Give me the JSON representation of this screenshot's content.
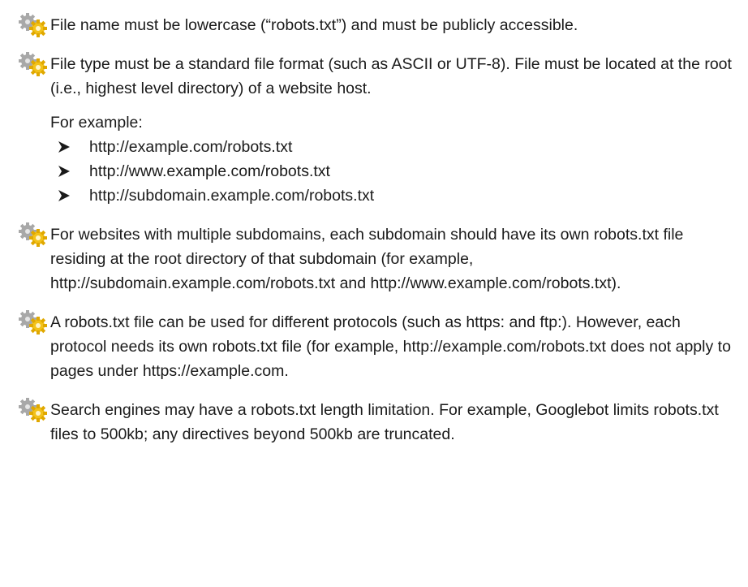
{
  "bullets": [
    {
      "text": "File name must be lowercase (“robots.txt”) and must be publicly accessible."
    },
    {
      "text": "File type must be a standard file format (such as ASCII or UTF-8). File must be located at the root (i.e., highest level directory) of a website host.",
      "example_intro": "For example:",
      "examples": [
        "http://example.com/robots.txt",
        "http://www.example.com/robots.txt",
        "http://subdomain.example.com/robots.txt"
      ]
    },
    {
      "text": "For websites with multiple subdomains, each subdomain should have its own robots.txt file residing at the root directory of that subdomain (for example, http://subdomain.example.com/robots.txt and http://www.example.com/robots.txt)."
    },
    {
      "text": "A robots.txt file can be used for different protocols (such as https: and ftp:). However, each protocol needs its own robots.txt file (for example, http://example.com/robots.txt does not apply to pages under https://example.com."
    },
    {
      "text": "Search engines may have a robots.txt length limitation. For example, Googlebot limits robots.txt files to 500kb; any directives beyond 500kb are truncated."
    }
  ],
  "icons": {
    "bullet": "gears-icon",
    "list_marker": "arrow-right-icon"
  },
  "colors": {
    "text": "#1a1a1a",
    "gear_gray": "#9a9a9a",
    "gear_gold": "#e8b400"
  }
}
